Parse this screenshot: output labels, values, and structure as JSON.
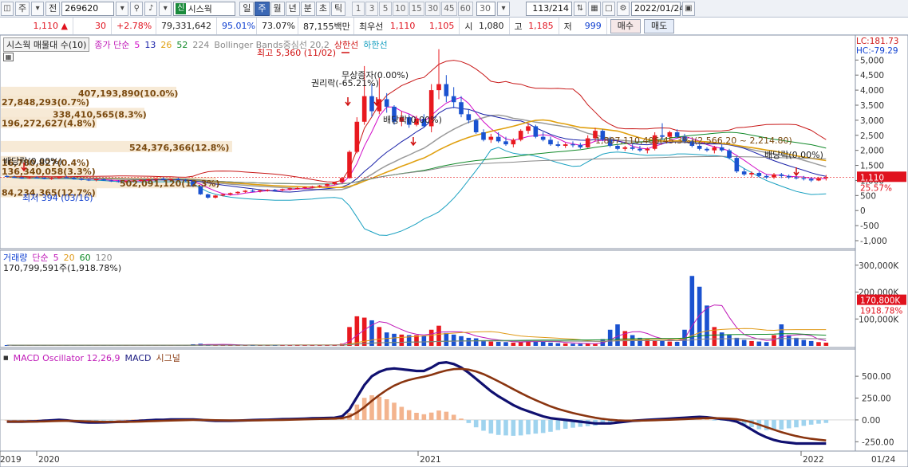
{
  "toolbar": {
    "market_type": "주",
    "market_sub": "전",
    "code": "269620",
    "stock_tag": "신",
    "stock_name": "시스웍",
    "periods": [
      "일",
      "주",
      "월",
      "년",
      "분",
      "초",
      "틱"
    ],
    "active_period": "주",
    "intervals": [
      "1",
      "3",
      "5",
      "10",
      "15",
      "30",
      "45",
      "60"
    ],
    "count_value": "30",
    "page_info": "113/214",
    "date": "2022/01/24"
  },
  "quote": {
    "price": "1,110",
    "change": "30",
    "change_pct": "+2.78%",
    "volume": "79,331,642",
    "vol_ratio": "95.01%",
    "turnover": "73.07%",
    "amount": "87,155백만",
    "best_label": "최우선",
    "best_ask": "1,110",
    "best_bid": "1,105",
    "open_label": "시",
    "open": "1,080",
    "high_label": "고",
    "high": "1,185",
    "low_label": "저",
    "low": "999",
    "buy_label": "매수",
    "sell_label": "매도"
  },
  "price_panel": {
    "legend_box": "시스웍 매물대 수(10)",
    "legend_ma": "종가 단순",
    "ma_periods": [
      "5",
      "13",
      "26",
      "52",
      "224"
    ],
    "ma_colors": [
      "#d10ac7",
      "#1820a8",
      "#e0a010",
      "#128a2a",
      "#888888"
    ],
    "bb_label": "Bollinger Bands중심선 20,2",
    "upper_label": "상한선",
    "lower_label": "하한선",
    "lc_label": "LC:181.73",
    "hc_label": "HC:-79.29",
    "y_ticks": [
      "5,000",
      "4,500",
      "4,000",
      "3,500",
      "3,000",
      "2,500",
      "2,000",
      "1,500",
      "1,000",
      "500",
      "0",
      "-500",
      "-1,000"
    ],
    "current_price_tag": "1,110",
    "current_pct_tag": "25.57%",
    "annotations": {
      "high": "최고 5,360 (11/02)",
      "low": "최저 394 (03/16)",
      "bonus": "무상증자(0.00%)",
      "rights": "권리락(-65.21%)",
      "dividend1": "배당락(0.00%)",
      "dividend2": "배당락(0.00%)",
      "dividend3": "배당락(0.00%)",
      "range": "1,807,110,406(45.3%)(2,566.20 ~ 2,214.80)"
    },
    "volume_profile": [
      "407,193,890(10.0%)",
      "27,848,293(0.7%)",
      "338,410,565(8.3%)",
      "196,272,627(4.8%)",
      "524,376,366(12.8%)",
      "16,780,827(0.4%)",
      "136,340,058(3.3%)",
      "502,091,120(12.3%)",
      "84,234,365(12.7%)"
    ]
  },
  "volume_panel": {
    "label": "거래량",
    "ma_label": "단순",
    "periods": [
      "5",
      "20",
      "60",
      "120"
    ],
    "period_colors": [
      "#c01ab8",
      "#e09a18",
      "#0e8a26",
      "#888888"
    ],
    "summary": "170,799,591주(1,918.78%)",
    "y_ticks": [
      "300,000K",
      "200,000K",
      "100,000K"
    ],
    "current_tag": "170,800K",
    "current_pct": "1918.78%"
  },
  "macd_panel": {
    "label_osc": "MACD Oscillator 12,26,9",
    "label_macd": "MACD",
    "label_signal": "시그널",
    "y_ticks": [
      "500.00",
      "250.00",
      "0.00",
      "-250.00"
    ]
  },
  "xaxis": {
    "labels": [
      "2019",
      "2020",
      "2021",
      "2022"
    ],
    "right_label": "01/24"
  },
  "chart_data": {
    "type": "candlestick",
    "ylim": [
      -1000,
      5300
    ],
    "weeks": 114,
    "candles": [
      [
        1150,
        1180,
        1100,
        1120
      ],
      [
        1120,
        1160,
        1080,
        1100
      ],
      [
        1100,
        1130,
        1060,
        1080
      ],
      [
        1080,
        1120,
        1050,
        1100
      ],
      [
        1100,
        1140,
        1070,
        1090
      ],
      [
        1090,
        1110,
        1040,
        1060
      ],
      [
        1060,
        1100,
        1020,
        1080
      ],
      [
        1080,
        1130,
        1050,
        1110
      ],
      [
        1110,
        1150,
        1080,
        1090
      ],
      [
        1090,
        1120,
        1030,
        1050
      ],
      [
        1050,
        1080,
        1000,
        1030
      ],
      [
        1030,
        1060,
        980,
        1010
      ],
      [
        1010,
        1050,
        970,
        1040
      ],
      [
        1040,
        1070,
        990,
        1000
      ],
      [
        1000,
        1030,
        950,
        980
      ],
      [
        980,
        1010,
        930,
        960
      ],
      [
        960,
        1000,
        920,
        980
      ],
      [
        980,
        1020,
        940,
        1000
      ],
      [
        1000,
        1040,
        960,
        1020
      ],
      [
        1020,
        1060,
        980,
        1040
      ],
      [
        1040,
        1080,
        1000,
        1060
      ],
      [
        1060,
        1100,
        1010,
        1030
      ],
      [
        1030,
        1070,
        990,
        1050
      ],
      [
        1050,
        1090,
        1000,
        1020
      ],
      [
        1020,
        1050,
        960,
        980
      ],
      [
        980,
        1000,
        780,
        800
      ],
      [
        800,
        820,
        520,
        540
      ],
      [
        540,
        560,
        394,
        430
      ],
      [
        430,
        520,
        400,
        500
      ],
      [
        500,
        560,
        470,
        540
      ],
      [
        540,
        600,
        500,
        580
      ],
      [
        580,
        640,
        540,
        620
      ],
      [
        620,
        680,
        580,
        660
      ],
      [
        660,
        700,
        610,
        640
      ],
      [
        640,
        690,
        600,
        670
      ],
      [
        670,
        710,
        630,
        690
      ],
      [
        690,
        720,
        650,
        680
      ],
      [
        680,
        730,
        640,
        710
      ],
      [
        710,
        760,
        670,
        740
      ],
      [
        740,
        780,
        700,
        750
      ],
      [
        750,
        800,
        720,
        780
      ],
      [
        780,
        820,
        740,
        800
      ],
      [
        800,
        850,
        760,
        830
      ],
      [
        830,
        900,
        790,
        880
      ],
      [
        880,
        960,
        850,
        940
      ],
      [
        940,
        1100,
        920,
        1080
      ],
      [
        1080,
        2000,
        1060,
        1950
      ],
      [
        1950,
        3100,
        1900,
        2950
      ],
      [
        2950,
        4800,
        2850,
        3800
      ],
      [
        3800,
        4200,
        3100,
        3300
      ],
      [
        3300,
        4400,
        3200,
        3700
      ],
      [
        3700,
        3900,
        3250,
        3450
      ],
      [
        3450,
        3500,
        2850,
        2950
      ],
      [
        2950,
        3300,
        2800,
        3100
      ],
      [
        3100,
        3200,
        2750,
        2850
      ],
      [
        2850,
        3150,
        2800,
        3050
      ],
      [
        3050,
        3200,
        2750,
        2800
      ],
      [
        2800,
        4200,
        2600,
        4000
      ],
      [
        4000,
        5360,
        3700,
        4200
      ],
      [
        4200,
        4500,
        3600,
        3800
      ],
      [
        3800,
        4100,
        3400,
        3600
      ],
      [
        3600,
        3800,
        3100,
        3200
      ],
      [
        3200,
        3350,
        2900,
        3000
      ],
      [
        3000,
        3050,
        2550,
        2600
      ],
      [
        2600,
        2700,
        2300,
        2350
      ],
      [
        2350,
        2550,
        2250,
        2450
      ],
      [
        2450,
        2600,
        2250,
        2300
      ],
      [
        2300,
        2450,
        2150,
        2200
      ],
      [
        2200,
        2400,
        2100,
        2350
      ],
      [
        2350,
        2700,
        2300,
        2650
      ],
      [
        2650,
        2900,
        2550,
        2800
      ],
      [
        2800,
        2850,
        2400,
        2450
      ],
      [
        2450,
        2600,
        2300,
        2350
      ],
      [
        2350,
        2450,
        2150,
        2200
      ],
      [
        2200,
        2300,
        2100,
        2150
      ],
      [
        2150,
        2250,
        2080,
        2200
      ],
      [
        2200,
        2300,
        2100,
        2180
      ],
      [
        2180,
        2250,
        2050,
        2100
      ],
      [
        2100,
        2500,
        2080,
        2400
      ],
      [
        2400,
        2750,
        2300,
        2650
      ],
      [
        2650,
        2700,
        2300,
        2350
      ],
      [
        2350,
        2450,
        2100,
        2150
      ],
      [
        2150,
        2200,
        2000,
        2050
      ],
      [
        2050,
        2150,
        1980,
        2100
      ],
      [
        2100,
        2200,
        2000,
        2050
      ],
      [
        2050,
        2150,
        1950,
        2000
      ],
      [
        2000,
        2100,
        1900,
        2050
      ],
      [
        2050,
        2600,
        2000,
        2500
      ],
      [
        2500,
        2900,
        2350,
        2450
      ],
      [
        2450,
        2650,
        2300,
        2600
      ],
      [
        2600,
        2700,
        2400,
        2450
      ],
      [
        2450,
        2550,
        2250,
        2300
      ],
      [
        2300,
        2350,
        2100,
        2150
      ],
      [
        2150,
        2200,
        2000,
        2050
      ],
      [
        2050,
        2100,
        1950,
        2000
      ],
      [
        2000,
        2150,
        1900,
        2100
      ],
      [
        2100,
        2200,
        1950,
        2000
      ],
      [
        2000,
        2050,
        1700,
        1750
      ],
      [
        1750,
        1800,
        1250,
        1300
      ],
      [
        1300,
        1400,
        1150,
        1200
      ],
      [
        1200,
        1300,
        1100,
        1250
      ],
      [
        1250,
        1300,
        1100,
        1150
      ],
      [
        1150,
        1200,
        1050,
        1100
      ],
      [
        1100,
        1250,
        1050,
        1200
      ],
      [
        1200,
        1250,
        1080,
        1150
      ],
      [
        1150,
        1200,
        1050,
        1100
      ],
      [
        1100,
        1180,
        1030,
        1080
      ],
      [
        1080,
        1150,
        1000,
        1050
      ],
      [
        1050,
        1100,
        950,
        1000
      ],
      [
        1000,
        1120,
        980,
        1080
      ],
      [
        1080,
        1185,
        999,
        1110
      ]
    ],
    "volume": [
      3,
      2,
      2,
      3,
      2,
      2,
      2,
      3,
      2,
      2,
      2,
      2,
      3,
      2,
      2,
      2,
      2,
      2,
      2,
      2,
      2,
      2,
      2,
      2,
      3,
      6,
      8,
      6,
      4,
      4,
      3,
      3,
      3,
      3,
      3,
      3,
      3,
      3,
      3,
      3,
      3,
      3,
      3,
      3,
      4,
      8,
      70,
      110,
      105,
      95,
      70,
      50,
      45,
      42,
      40,
      40,
      38,
      60,
      75,
      48,
      42,
      36,
      30,
      28,
      20,
      16,
      15,
      14,
      12,
      14,
      22,
      18,
      16,
      12,
      10,
      9,
      8,
      8,
      9,
      7,
      25,
      60,
      80,
      55,
      40,
      30,
      25,
      20,
      18,
      16,
      15,
      60,
      260,
      220,
      150,
      70,
      50,
      40,
      30,
      22,
      18,
      16,
      14,
      40,
      80,
      40,
      30,
      22,
      18,
      14,
      12,
      10,
      8,
      12,
      170
    ],
    "macd": [
      -20,
      -20,
      -20,
      -18,
      -15,
      -10,
      -5,
      0,
      -5,
      -15,
      -25,
      -30,
      -30,
      -28,
      -25,
      -22,
      -20,
      -15,
      -10,
      -5,
      0,
      0,
      5,
      5,
      5,
      5,
      0,
      -5,
      -10,
      -10,
      -10,
      -8,
      -5,
      -2,
      0,
      2,
      5,
      8,
      10,
      12,
      15,
      18,
      20,
      22,
      25,
      40,
      120,
      260,
      400,
      500,
      550,
      580,
      590,
      580,
      570,
      560,
      560,
      600,
      650,
      660,
      640,
      600,
      540,
      470,
      400,
      330,
      270,
      220,
      170,
      130,
      100,
      70,
      40,
      20,
      10,
      0,
      -10,
      -20,
      -30,
      -40,
      -40,
      -40,
      -30,
      -20,
      -10,
      -5,
      0,
      5,
      10,
      15,
      20,
      25,
      30,
      35,
      30,
      20,
      10,
      0,
      -20,
      -60,
      -110,
      -160,
      -200,
      -230,
      -250,
      -260,
      -270,
      -270,
      -270,
      -270,
      -270,
      -270,
      -270,
      -265,
      -260
    ]
  }
}
